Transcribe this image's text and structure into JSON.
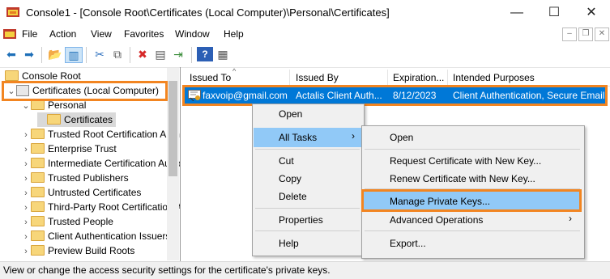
{
  "window": {
    "title": "Console1 - [Console Root\\Certificates (Local Computer)\\Personal\\Certificates]",
    "minimize": "—",
    "maximize": "☐",
    "close": "✕"
  },
  "menubar": {
    "items": [
      "File",
      "Action",
      "View",
      "Favorites",
      "Window",
      "Help"
    ]
  },
  "tree": {
    "root": "Console Root",
    "certificates_local": "Certificates (Local Computer)",
    "personal": "Personal",
    "certificates": "Certificates",
    "stores": [
      "Trusted Root Certification Authorities",
      "Enterprise Trust",
      "Intermediate Certification Authorities",
      "Trusted Publishers",
      "Untrusted Certificates",
      "Third-Party Root Certification Authorities",
      "Trusted People",
      "Client Authentication Issuers",
      "Preview Build Roots"
    ]
  },
  "columns": [
    "Issued To",
    "Issued By",
    "Expiration...",
    "Intended Purposes"
  ],
  "cert": {
    "issued_to": "faxvoip@gmail.com",
    "issued_by": "Actalis Client Auth...",
    "expiration": "8/12/2023",
    "purposes": "Client Authentication, Secure Email"
  },
  "context_menu": {
    "open": "Open",
    "all_tasks": "All Tasks",
    "cut": "Cut",
    "copy": "Copy",
    "delete": "Delete",
    "properties": "Properties",
    "help": "Help"
  },
  "submenu": {
    "open": "Open",
    "request_new_key": "Request Certificate with New Key...",
    "renew_new_key": "Renew Certificate with New Key...",
    "manage_private_keys": "Manage Private Keys...",
    "advanced_operations": "Advanced Operations",
    "export": "Export..."
  },
  "status": "View or change the access security settings for the certificate's private keys.",
  "colors": {
    "accent": "#0078d7",
    "highlight_box": "#f28521",
    "menu_selected": "#91c9f7"
  }
}
